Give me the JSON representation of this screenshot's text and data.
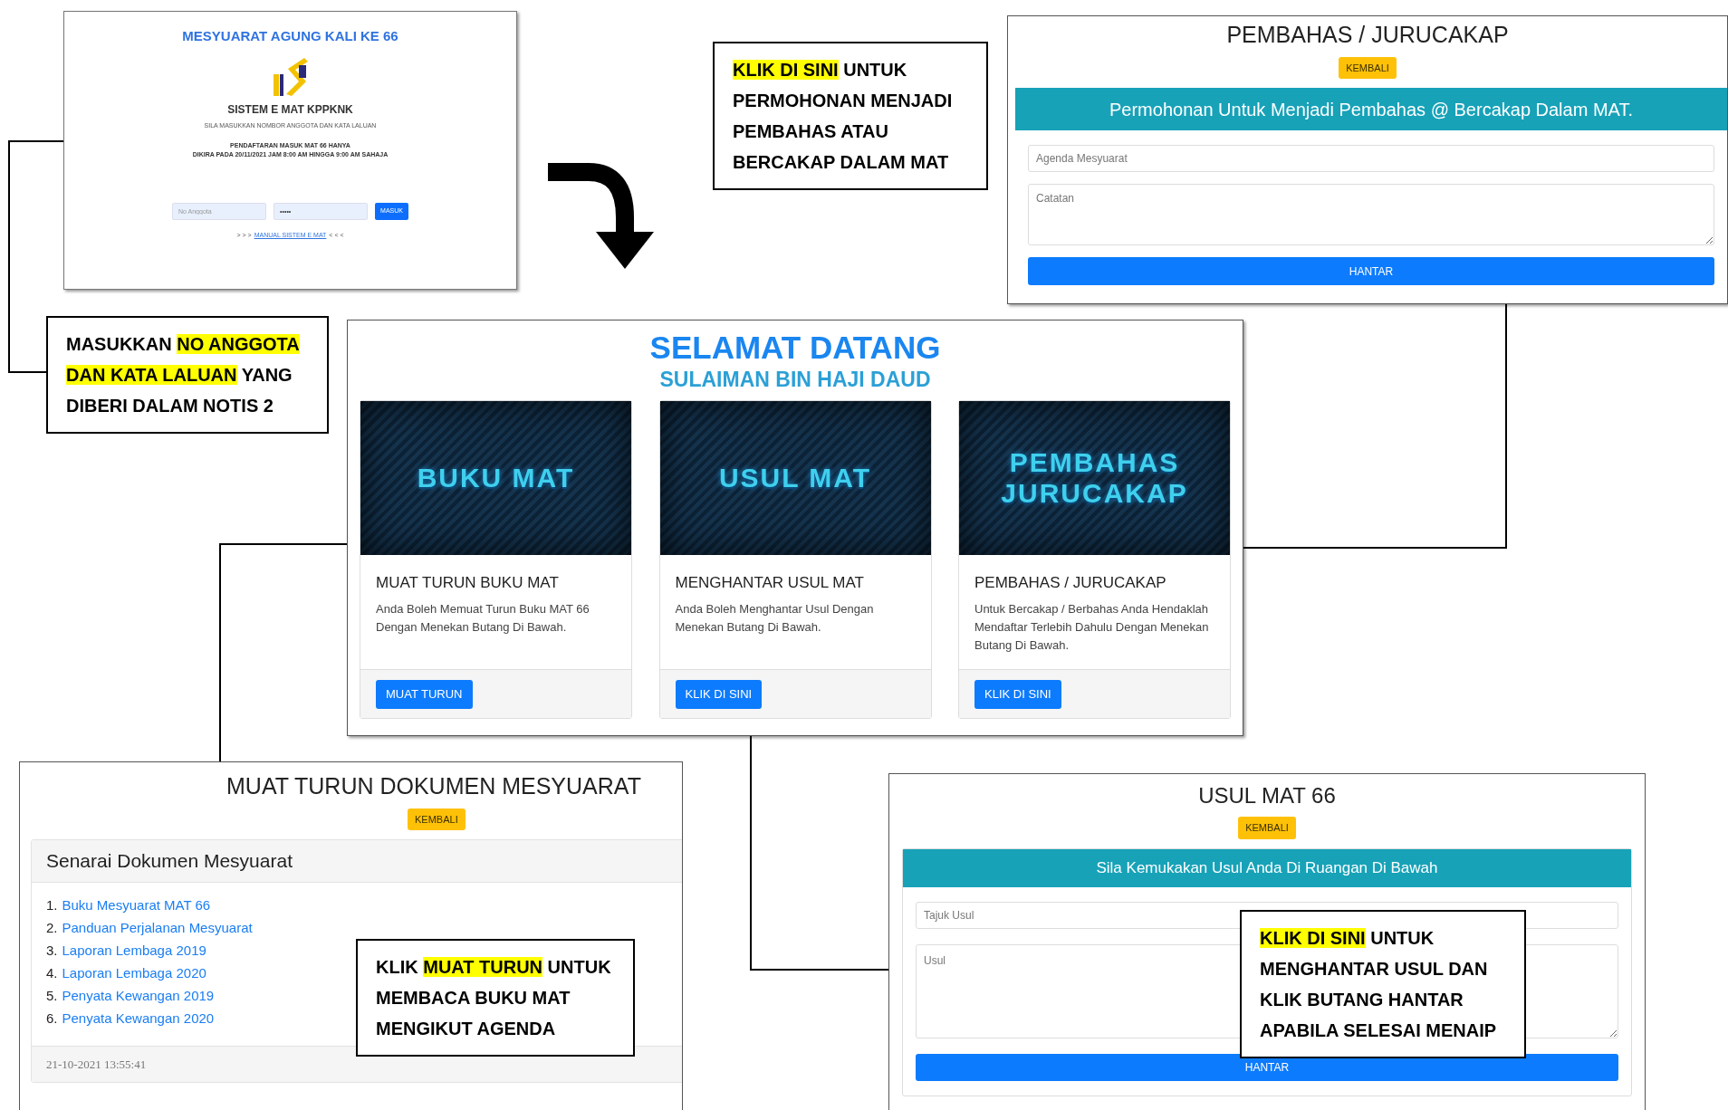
{
  "login_screen": {
    "heading": "MESYUARAT AGUNG KALI KE 66",
    "system_name": "SISTEM E MAT KPPKNK",
    "instruction": "SILA MASUKKAN NOMBOR ANGGOTA DAN KATA LALUAN",
    "notice_lines": [
      "PENDAFTARAN MASUK MAT 66 HANYA",
      "DIKIRA PADA 20/11/2021 JAM 8:00 AM HINGGA 9:00 AM SAHAJA"
    ],
    "member_field": {
      "placeholder": "No Anggota"
    },
    "password_field": {
      "value": "•••••"
    },
    "login_button": "MASUK",
    "manual_link": {
      "before": "> > >",
      "label": "MANUAL SISTEM E MAT",
      "after": "< < <"
    }
  },
  "speaker_screen": {
    "title": "PEMBAHAS / JURUCAKAP",
    "back_button": "KEMBALI",
    "banner": "Permohonan Untuk Menjadi Pembahas @ Bercakap Dalam MAT.",
    "agenda_field": {
      "placeholder": "Agenda Mesyuarat"
    },
    "notes_field": {
      "placeholder": "Catatan"
    },
    "submit_button": "HANTAR"
  },
  "welcome_screen": {
    "title": "SELAMAT DATANG",
    "user_name": "SULAIMAN BIN HAJI DAUD",
    "cards": [
      {
        "banner_lines": [
          "BUKU MAT"
        ],
        "title": "MUAT TURUN BUKU MAT",
        "description": "Anda Boleh Memuat Turun Buku MAT 66 Dengan Menekan Butang Di Bawah.",
        "button": "MUAT TURUN"
      },
      {
        "banner_lines": [
          "USUL MAT"
        ],
        "title": "MENGHANTAR USUL MAT",
        "description": "Anda Boleh Menghantar Usul Dengan Menekan Butang Di Bawah.",
        "button": "KLIK DI SINI"
      },
      {
        "banner_lines": [
          "PEMBAHAS",
          "JURUCAKAP"
        ],
        "title": "PEMBAHAS / JURUCAKAP",
        "description": "Untuk Bercakap / Berbahas Anda Hendaklah Mendaftar Terlebih Dahulu Dengan Menekan Butang Di Bawah.",
        "button": "KLIK DI SINI"
      }
    ]
  },
  "documents_screen": {
    "title": "MUAT TURUN DOKUMEN MESYUARAT",
    "back_button": "KEMBALI",
    "list_title": "Senarai Dokumen Mesyuarat",
    "documents": [
      {
        "number": "1.",
        "label": "Buku Mesyuarat MAT 66"
      },
      {
        "number": "2.",
        "label": "Panduan Perjalanan Mesyuarat"
      },
      {
        "number": "3.",
        "label": "Laporan Lembaga 2019"
      },
      {
        "number": "4.",
        "label": "Laporan Lembaga 2020"
      },
      {
        "number": "5.",
        "label": "Penyata Kewangan 2019"
      },
      {
        "number": "6.",
        "label": "Penyata Kewangan 2020"
      }
    ],
    "timestamp": "21-10-2021 13:55:41"
  },
  "proposal_screen": {
    "title": "USUL MAT 66",
    "back_button": "KEMBALI",
    "banner": "Sila Kemukakan Usul Anda Di Ruangan Di Bawah",
    "title_field": {
      "placeholder": "Tajuk Usul"
    },
    "proposal_field": {
      "placeholder": "Usul"
    },
    "submit_button": "HANTAR"
  },
  "callouts": [
    {
      "segments": [
        {
          "text": "MASUKKAN ",
          "highlighted": false
        },
        {
          "text": "NO ANGGOTA DAN KATA LALUAN",
          "highlighted": true
        },
        {
          "text": " YANG DIBERI DALAM NOTIS 2",
          "highlighted": false
        }
      ]
    },
    {
      "segments": [
        {
          "text": "KLIK DI SINI",
          "highlighted": true
        },
        {
          "text": " UNTUK PERMOHONAN MENJADI PEMBAHAS ATAU BERCAKAP DALAM MAT",
          "highlighted": false
        }
      ]
    },
    {
      "segments": [
        {
          "text": "KLIK ",
          "highlighted": false
        },
        {
          "text": "MUAT TURUN",
          "highlighted": true
        },
        {
          "text": " UNTUK MEMBACA BUKU MAT MENGIKUT AGENDA",
          "highlighted": false
        }
      ]
    },
    {
      "segments": [
        {
          "text": "KLIK DI SINI",
          "highlighted": true
        },
        {
          "text": " UNTUK MENGHANTAR USUL DAN KLIK BUTANG HANTAR APABILA SELESAI MENAIP",
          "highlighted": false
        }
      ]
    }
  ]
}
